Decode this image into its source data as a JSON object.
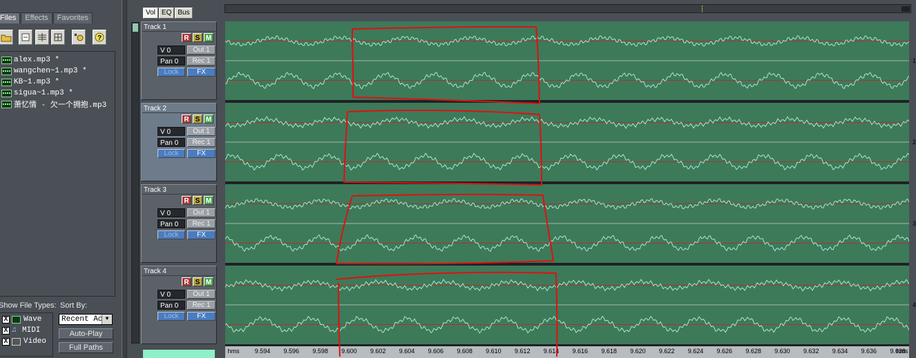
{
  "left_tabs": [
    "Files",
    "Effects",
    "Favorites"
  ],
  "files": [
    "alex.mp3 *",
    "wangchen~1.mp3 *",
    "KB~1.mp3 *",
    "sigua~1.mp3 *",
    "萧忆情 - 欠一个拥抱.mp3"
  ],
  "show_file_types": {
    "label": "Show File Types:",
    "items": [
      {
        "label": "Wave",
        "checked": "X"
      },
      {
        "label": "MIDI",
        "checked": "X"
      },
      {
        "label": "Video",
        "checked": "X"
      }
    ]
  },
  "sort": {
    "label": "Sort By:",
    "value": "Recent Acc"
  },
  "buttons": {
    "auto_play": "Auto-Play",
    "full_paths": "Full Paths"
  },
  "control_tabs": [
    "Vol",
    "EQ",
    "Bus"
  ],
  "tracks": [
    {
      "name": "Track 1",
      "volume": "V 0",
      "pan": "Pan 0",
      "out": "Out 1",
      "rec": "Rec 1",
      "lock": "Lock",
      "fx": "FX",
      "r": "R",
      "s": "S",
      "m": "M"
    },
    {
      "name": "Track 2",
      "volume": "V 0",
      "pan": "Pan 0",
      "out": "Out 1",
      "rec": "Rec 1",
      "lock": "Lock",
      "fx": "FX",
      "r": "R",
      "s": "S",
      "m": "M"
    },
    {
      "name": "Track 3",
      "volume": "V 0",
      "pan": "Pan 0",
      "out": "Out 1",
      "rec": "Rec 1",
      "lock": "Lock",
      "fx": "FX",
      "r": "R",
      "s": "S",
      "m": "M"
    },
    {
      "name": "Track 4",
      "volume": "V 0",
      "pan": "Pan 0",
      "out": "Out 1",
      "rec": "Rec 1",
      "lock": "Lock",
      "fx": "FX",
      "r": "R",
      "s": "S",
      "m": "M"
    }
  ],
  "ruler": {
    "unit": "hms",
    "ticks": [
      "9.594",
      "9.596",
      "9.598",
      "9.600",
      "9.602",
      "9.604",
      "9.606",
      "9.608",
      "9.610",
      "9.612",
      "9.614",
      "9.616",
      "9.618",
      "9.620",
      "9.622",
      "9.624",
      "9.626",
      "9.628",
      "9.630",
      "9.632",
      "9.634",
      "9.636",
      "9.638"
    ]
  },
  "edge_numbers": [
    "1",
    "2",
    "3",
    "4"
  ],
  "colors": {
    "wave_bg": "#3d7a5a",
    "wave_line": "#a8e8d0",
    "center_line": "#b03030",
    "annotation": "#e01010"
  }
}
